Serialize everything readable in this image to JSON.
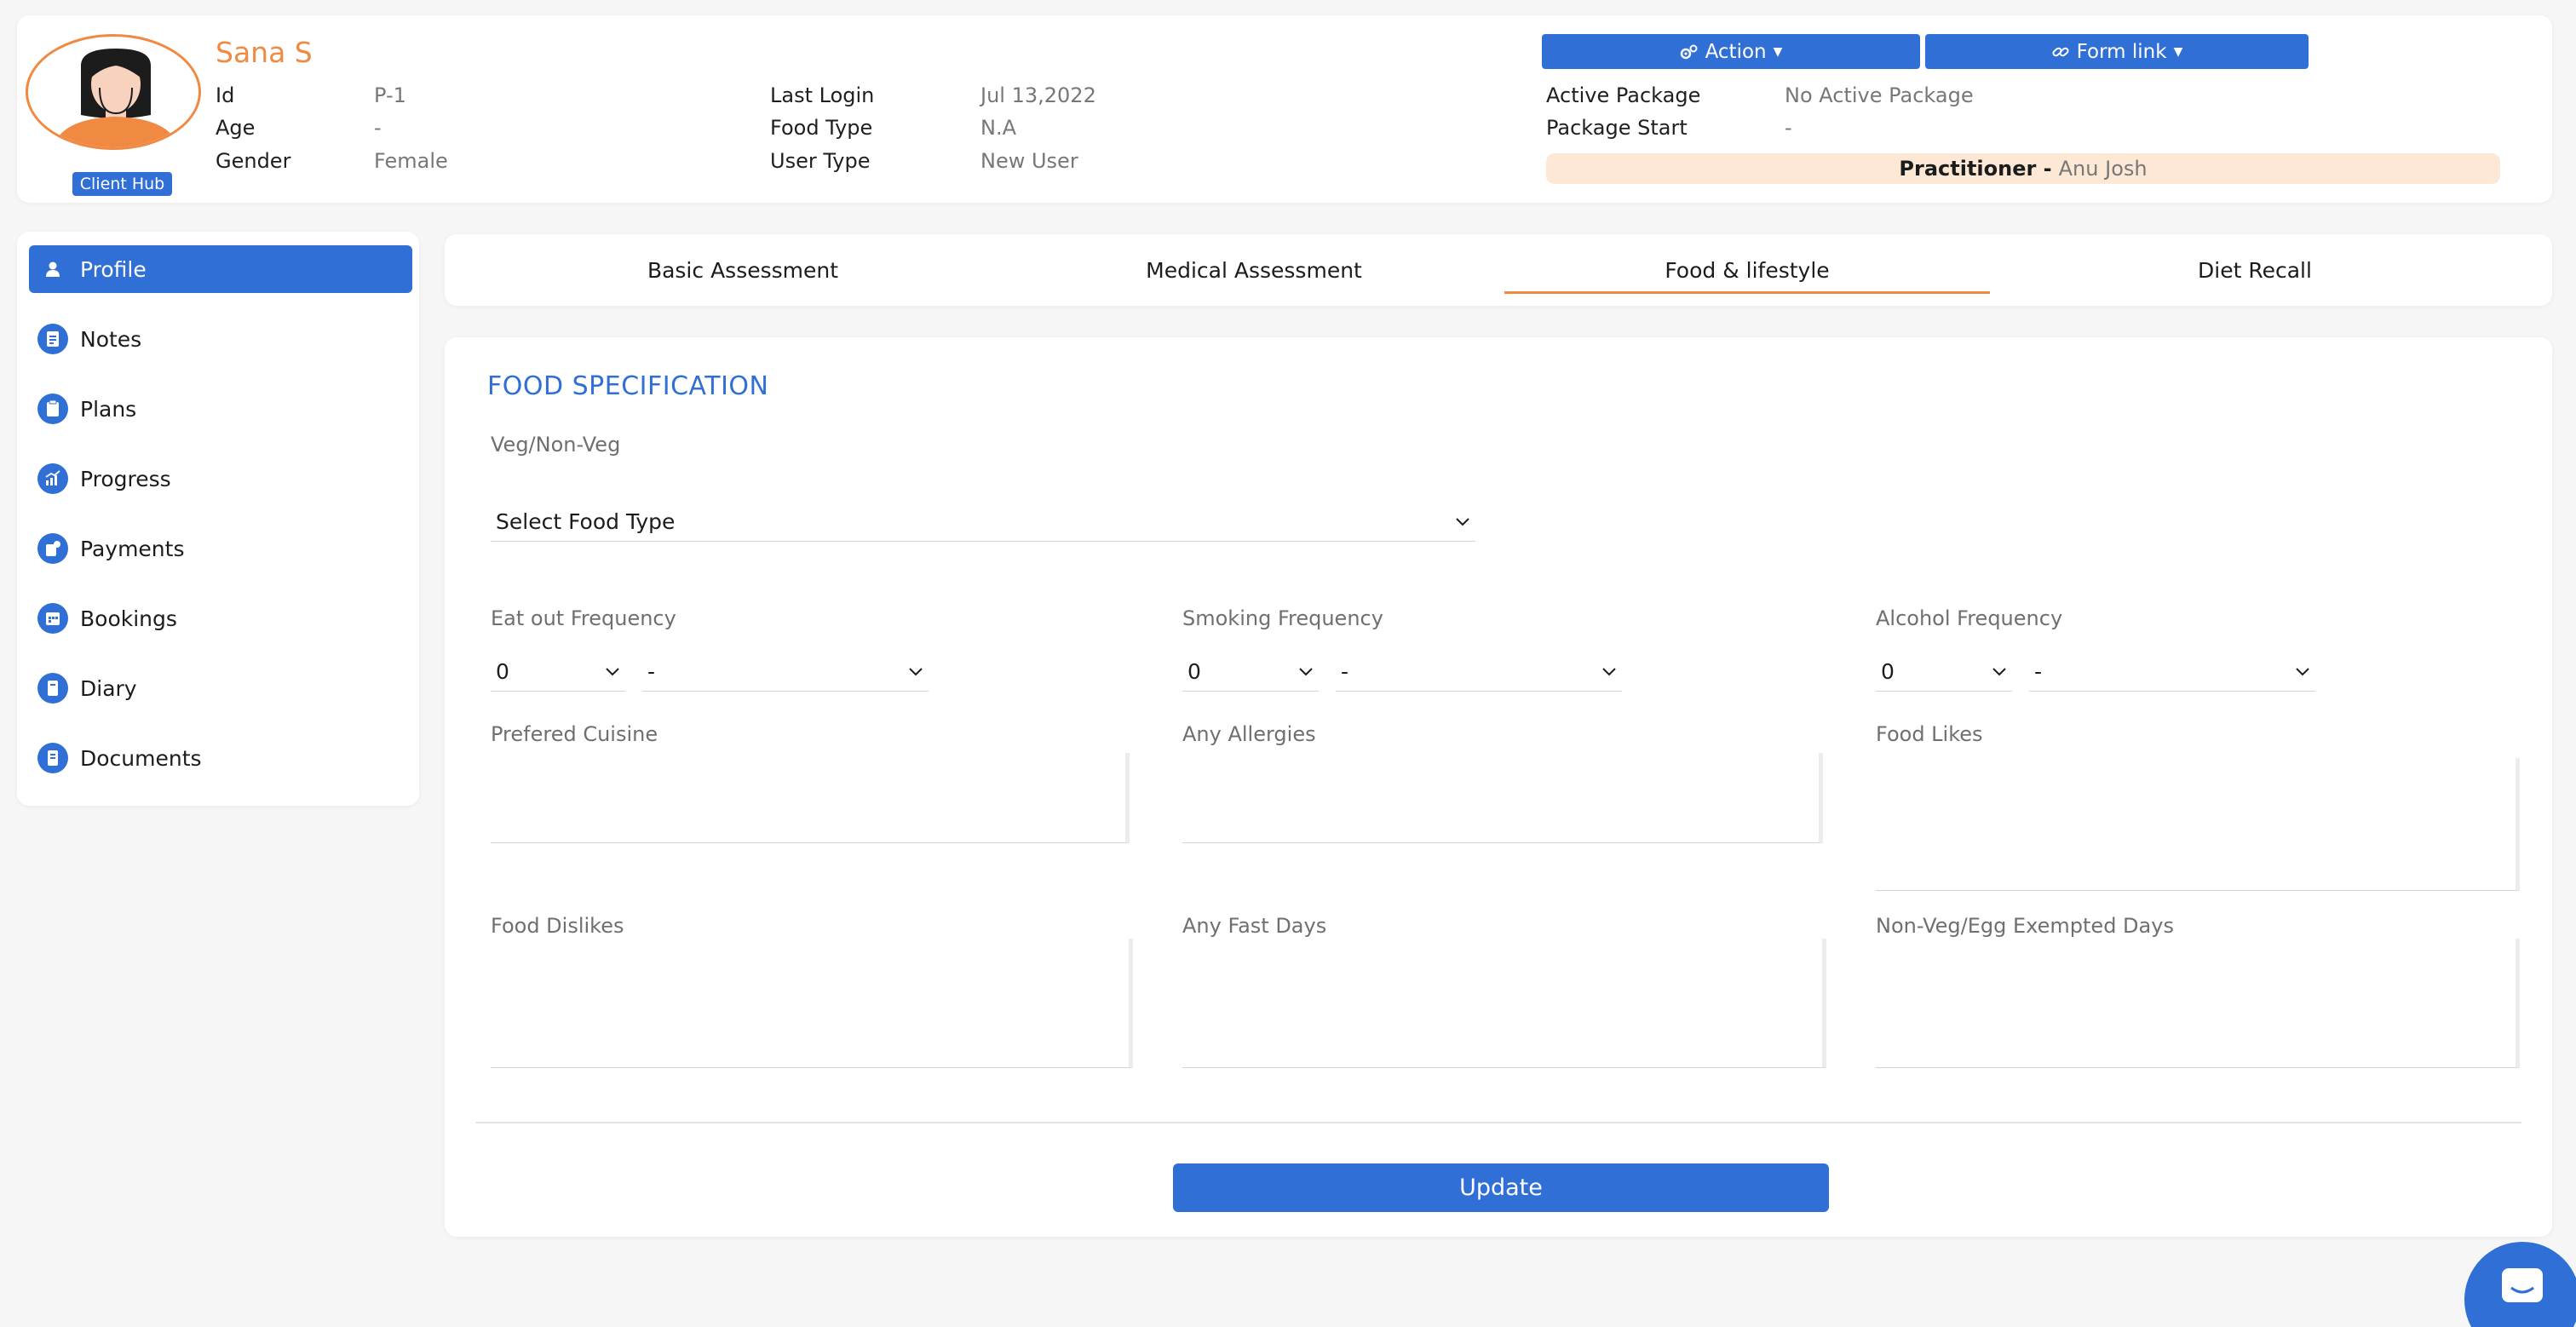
{
  "client": {
    "name": "Sana S",
    "hub_badge": "Client Hub",
    "details_left": [
      {
        "label": "Id",
        "value": "P-1"
      },
      {
        "label": "Age",
        "value": "-"
      },
      {
        "label": "Gender",
        "value": "Female"
      }
    ],
    "details_mid": [
      {
        "label": "Last Login",
        "value": "Jul 13,2022"
      },
      {
        "label": "Food Type",
        "value": "N.A"
      },
      {
        "label": "User Type",
        "value": "New User"
      }
    ],
    "details_right": [
      {
        "label": "Active Package",
        "value": "No Active Package"
      },
      {
        "label": "Package Start",
        "value": "-"
      }
    ],
    "practitioner_label": "Practitioner -",
    "practitioner_name": "Anu Josh"
  },
  "header_buttons": {
    "action": "Action",
    "form_link": "Form link"
  },
  "sidebar": {
    "items": [
      {
        "label": "Profile",
        "icon": "user-icon",
        "active": true
      },
      {
        "label": "Notes",
        "icon": "notes-icon",
        "active": false
      },
      {
        "label": "Plans",
        "icon": "plans-icon",
        "active": false
      },
      {
        "label": "Progress",
        "icon": "progress-icon",
        "active": false
      },
      {
        "label": "Payments",
        "icon": "payments-icon",
        "active": false
      },
      {
        "label": "Bookings",
        "icon": "bookings-icon",
        "active": false
      },
      {
        "label": "Diary",
        "icon": "diary-icon",
        "active": false
      },
      {
        "label": "Documents",
        "icon": "documents-icon",
        "active": false
      }
    ]
  },
  "tabs": [
    {
      "label": "Basic Assessment",
      "active": false
    },
    {
      "label": "Medical Assessment",
      "active": false
    },
    {
      "label": "Food & lifestyle",
      "active": true
    },
    {
      "label": "Diet Recall",
      "active": false
    }
  ],
  "form": {
    "section_title": "FOOD SPECIFICATION",
    "veg_label": "Veg/Non-Veg",
    "food_type_select": "Select Food Type",
    "eat_out": {
      "label": "Eat out Frequency",
      "count": "0",
      "period": "-"
    },
    "smoking": {
      "label": "Smoking Frequency",
      "count": "0",
      "period": "-"
    },
    "alcohol": {
      "label": "Alcohol Frequency",
      "count": "0",
      "period": "-"
    },
    "prefered_cuisine": "Prefered Cuisine",
    "allergies": "Any Allergies",
    "food_likes": "Food Likes",
    "food_dislikes": "Food Dislikes",
    "fast_days": "Any Fast Days",
    "exempted_days": "Non-Veg/Egg Exempted Days",
    "update_label": "Update"
  },
  "colors": {
    "accent": "#2f6fd6",
    "brand_orange": "#f08a43",
    "practitioner_bg": "#fde8d6"
  }
}
